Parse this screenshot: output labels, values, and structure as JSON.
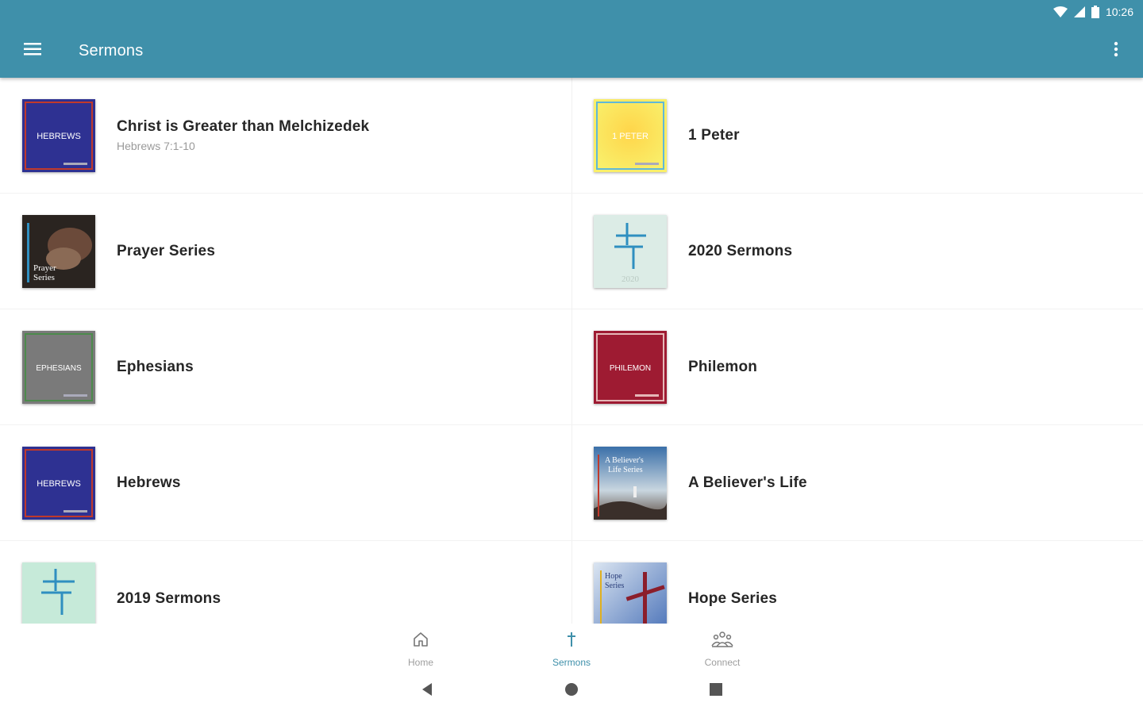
{
  "status_bar": {
    "time": "10:26"
  },
  "app_bar": {
    "title": "Sermons"
  },
  "sermons": [
    {
      "title": "Christ is Greater than Melchizedek",
      "subtitle": "Hebrews 7:1-10",
      "thumb_text": "HEBREWS"
    },
    {
      "title": "1 Peter",
      "subtitle": "",
      "thumb_text": "1 PETER"
    },
    {
      "title": "Prayer Series",
      "subtitle": "",
      "thumb_text": "Prayer Series"
    },
    {
      "title": "2020 Sermons",
      "subtitle": "",
      "thumb_text": "2020"
    },
    {
      "title": "Ephesians",
      "subtitle": "",
      "thumb_text": "EPHESIANS"
    },
    {
      "title": "Philemon",
      "subtitle": "",
      "thumb_text": "PHILEMON"
    },
    {
      "title": "Hebrews",
      "subtitle": "",
      "thumb_text": "HEBREWS"
    },
    {
      "title": "A Believer's Life",
      "subtitle": "",
      "thumb_text": "A Believer's Life Series"
    },
    {
      "title": "2019 Sermons",
      "subtitle": "",
      "thumb_text": ""
    },
    {
      "title": "Hope Series",
      "subtitle": "",
      "thumb_text": "Hope Series"
    }
  ],
  "bottom_nav": [
    {
      "label": "Home",
      "icon": "home-icon",
      "active": false
    },
    {
      "label": "Sermons",
      "icon": "cross-icon",
      "active": true
    },
    {
      "label": "Connect",
      "icon": "people-icon",
      "active": false
    }
  ],
  "colors": {
    "primary": "#3f90aa",
    "hebrews": "#2e3192",
    "peter": "#f7e34b",
    "ephesians": "#7a7a7a",
    "philemon": "#9e1b32"
  }
}
